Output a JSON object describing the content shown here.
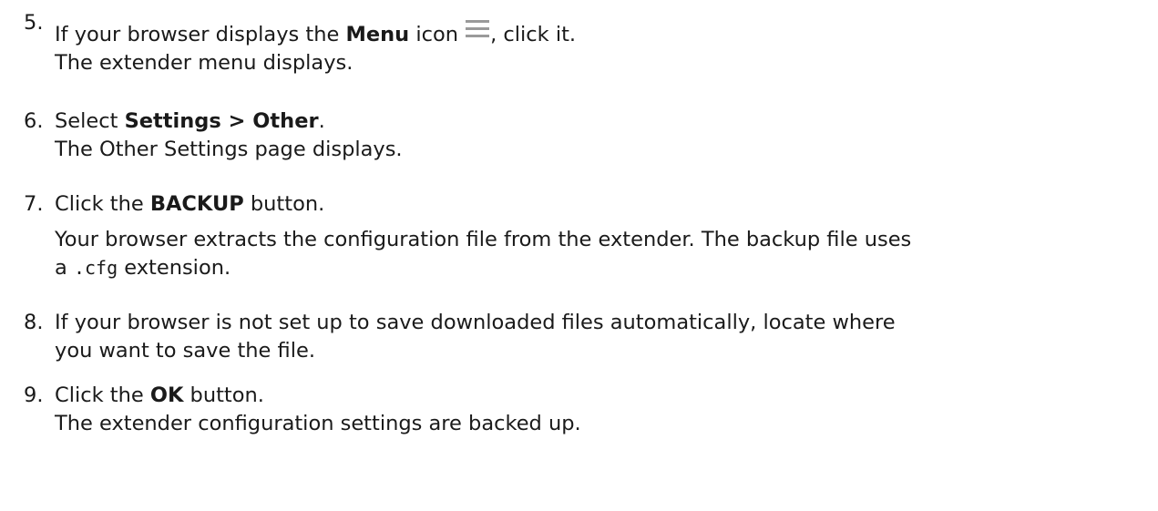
{
  "steps": [
    {
      "number": "5.",
      "lines": [
        {
          "t1": "If your browser displays the ",
          "b1": "Menu",
          "t2": " icon ",
          "icon": "menu-icon",
          "t3": ", click it."
        },
        {
          "text": "The extender menu displays."
        }
      ]
    },
    {
      "number": "6.",
      "lines": [
        {
          "t1": "Select ",
          "b1": "Settings > Other",
          "t2": "."
        },
        {
          "text": "The Other Settings page displays."
        }
      ]
    },
    {
      "number": "7.",
      "lines": [
        {
          "t1": "Click the ",
          "b1": "BACKUP",
          "t2": " button."
        },
        {
          "text": "Your browser extracts the configuration file from the extender. The backup file uses"
        },
        {
          "t1": "a ",
          "code": ".cfg",
          "t2": " extension."
        }
      ]
    },
    {
      "number": "8.",
      "lines": [
        {
          "text": "If your browser is not set up to save downloaded files automatically, locate where"
        },
        {
          "text2": "you want to save the file."
        }
      ]
    },
    {
      "number": "9.",
      "lines": [
        {
          "t1": "Click the ",
          "b1": "OK",
          "t2": " button."
        },
        {
          "text": "The extender configuration settings are backed up."
        }
      ]
    }
  ]
}
